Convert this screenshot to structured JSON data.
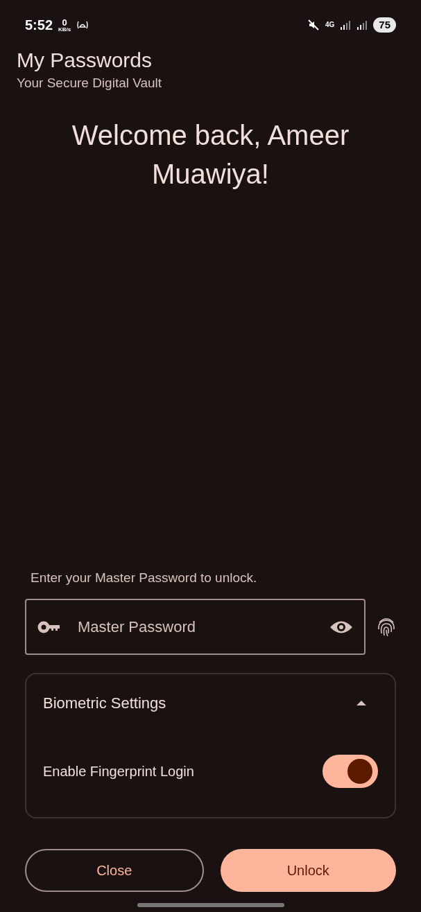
{
  "status_bar": {
    "time": "5:52",
    "speed_value": "0",
    "speed_unit": "KB/s",
    "network": "4G",
    "battery": "75"
  },
  "header": {
    "title": "My Passwords",
    "subtitle": "Your Secure Digital Vault"
  },
  "welcome": "Welcome back, Ameer Muawiya!",
  "prompt": "Enter your Master Password to unlock.",
  "password_field": {
    "placeholder": "Master Password"
  },
  "biometric": {
    "title": "Biometric Settings",
    "expanded": true,
    "toggle": {
      "label": "Enable Fingerprint Login",
      "on": true
    }
  },
  "buttons": [
    {
      "label": "Close",
      "kind": "outlined"
    },
    {
      "label": "Unlock",
      "kind": "filled"
    }
  ]
}
